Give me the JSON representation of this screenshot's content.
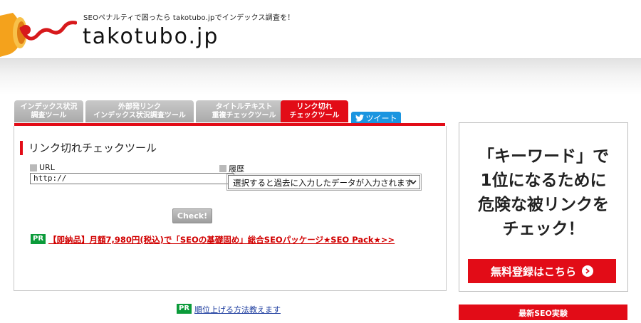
{
  "header": {
    "tagline": "SEOペナルティで困ったら takotubo.jpでインデックス調査を！",
    "site_title": "takotubo.jp"
  },
  "tabs": [
    {
      "label": "インデックス状況\n調査ツール",
      "active": false
    },
    {
      "label": "外部発リンク\nインデックス状況調査ツール",
      "active": false
    },
    {
      "label": "タイトルテキスト\n重複チェックツール",
      "active": false
    },
    {
      "label": "リンク切れ\nチェックツール",
      "active": true
    }
  ],
  "tweet_label": "ツイート",
  "tool": {
    "title": "リンク切れチェックツール",
    "url_label": "URL",
    "url_value": "http://",
    "history_label": "履歴",
    "history_selected": "選択すると過去に入力したデータが入力されます",
    "check_label": "Check!"
  },
  "pr": {
    "badge": "PR",
    "link_text": "【即納品】月額7,980円(税込)で「SEOの基礎固め」総合SEOパッケージ★SEO Pack★>>",
    "bottom_link_text": "順位上げる方法教えます"
  },
  "ad": {
    "line1": "「キーワード」で",
    "line2": "1位になるために",
    "line3": "危険な被リンクを",
    "line4": "チェック！",
    "button_label": "無料登録はこちら"
  },
  "sidebar": {
    "news_header": "最新SEO実験"
  },
  "colors": {
    "accent_red": "#e20c17",
    "pr_green": "#0b9b3a",
    "twitter_blue": "#1b95e0"
  }
}
